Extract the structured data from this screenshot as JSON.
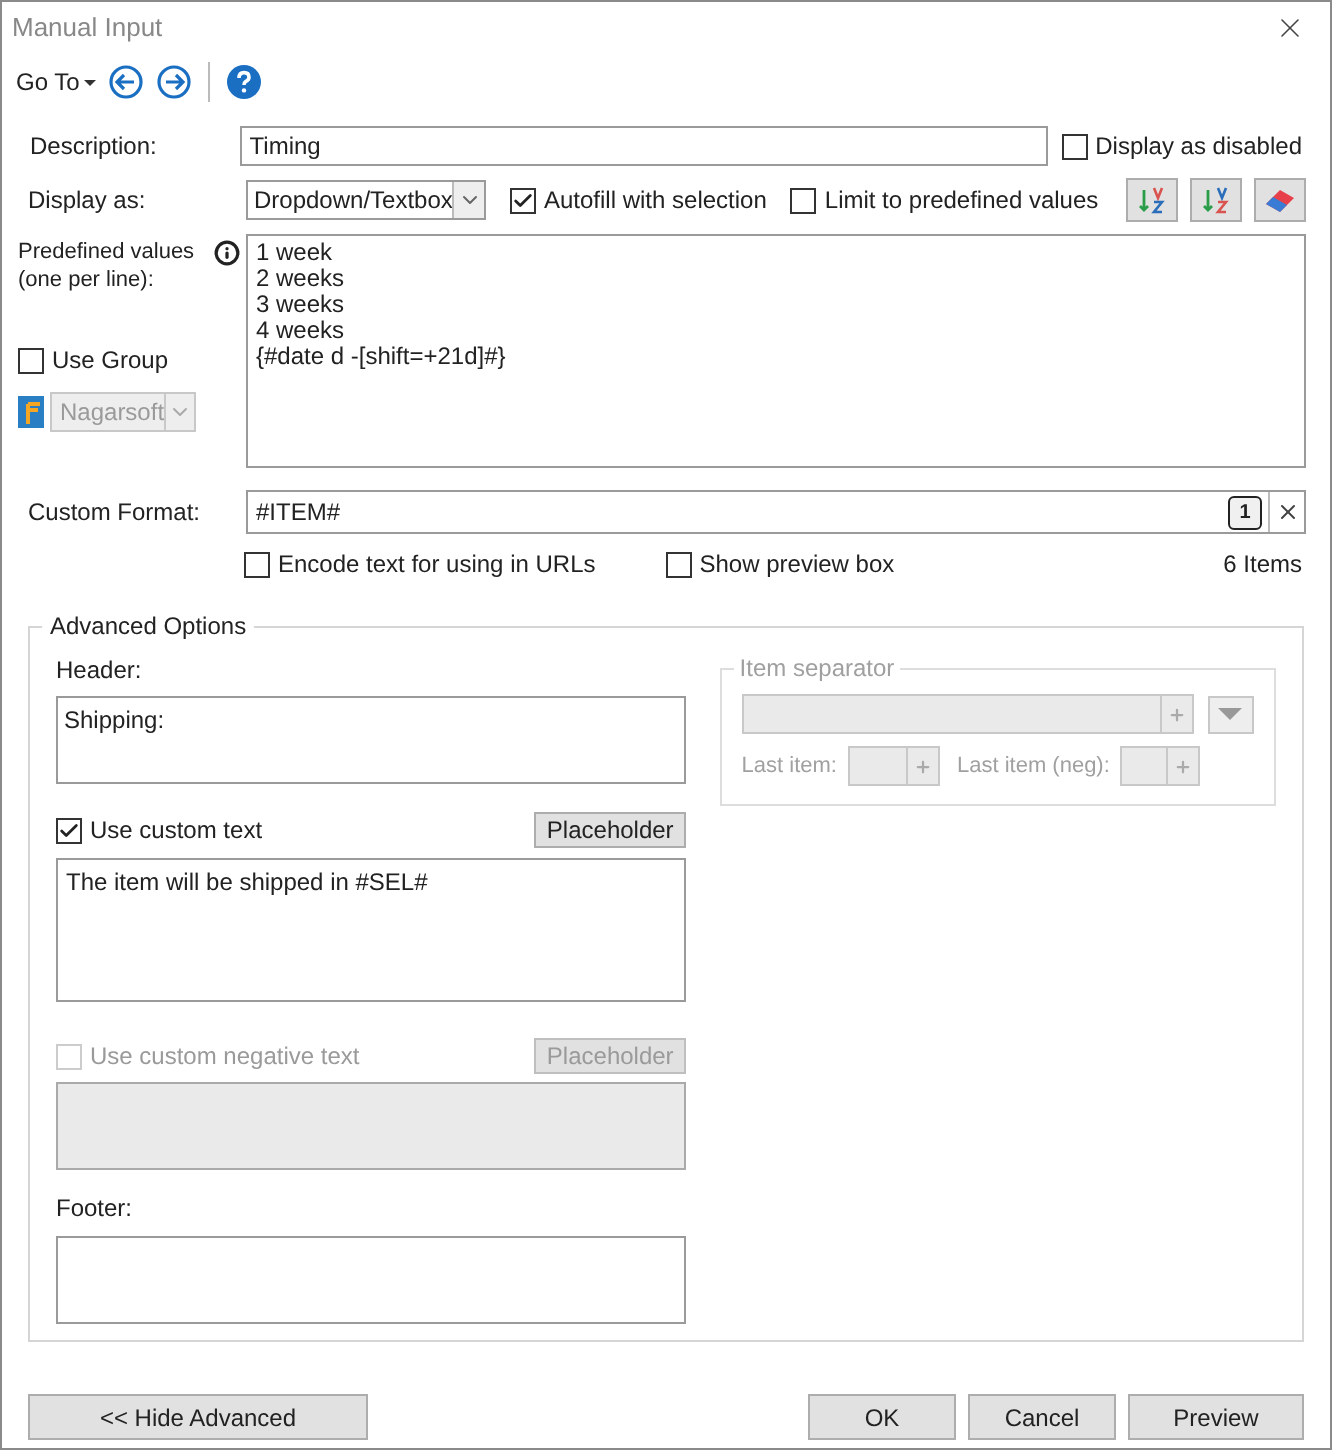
{
  "window": {
    "title": "Manual Input"
  },
  "toolbar": {
    "goto": "Go To"
  },
  "description": {
    "label": "Description:",
    "value": "Timing"
  },
  "display_as_disabled": {
    "label": "Display as disabled",
    "checked": false
  },
  "display_as": {
    "label": "Display as:",
    "value": "Dropdown/Textbox"
  },
  "autofill": {
    "label": "Autofill with selection",
    "checked": true
  },
  "limit": {
    "label": "Limit to predefined values",
    "checked": false
  },
  "predefined": {
    "label": "Predefined values (one per line):",
    "values": [
      "1 week",
      "2 weeks",
      "3 weeks",
      "4 weeks",
      "{#date d -[shift=+21d]#}"
    ]
  },
  "use_group": {
    "label": "Use Group",
    "checked": false
  },
  "group_select": {
    "value": "Nagarsoft",
    "disabled": true
  },
  "custom_format": {
    "label": "Custom Format:",
    "value": "#ITEM#",
    "badge": "1"
  },
  "encode": {
    "label": "Encode text for using in URLs",
    "checked": false
  },
  "preview_box": {
    "label": "Show preview box",
    "checked": false
  },
  "item_count": "6 Items",
  "advanced": {
    "title": "Advanced Options",
    "header": {
      "label": "Header:",
      "value": "Shipping:"
    },
    "use_custom_text": {
      "label": "Use custom text",
      "checked": true,
      "disabled": false
    },
    "custom_placeholder": {
      "label": "Placeholder",
      "disabled": false
    },
    "custom_text": "The item will be shipped in #SEL#",
    "use_negative": {
      "label": "Use custom negative text",
      "checked": false,
      "disabled": true
    },
    "negative_placeholder": {
      "label": "Placeholder",
      "disabled": true
    },
    "footer": {
      "label": "Footer:"
    },
    "separator": {
      "title": "Item separator",
      "last_item": "Last item:",
      "last_item_neg": "Last item (neg):"
    }
  },
  "buttons": {
    "hide_advanced": "<< Hide Advanced",
    "ok": "OK",
    "cancel": "Cancel",
    "preview": "Preview"
  }
}
